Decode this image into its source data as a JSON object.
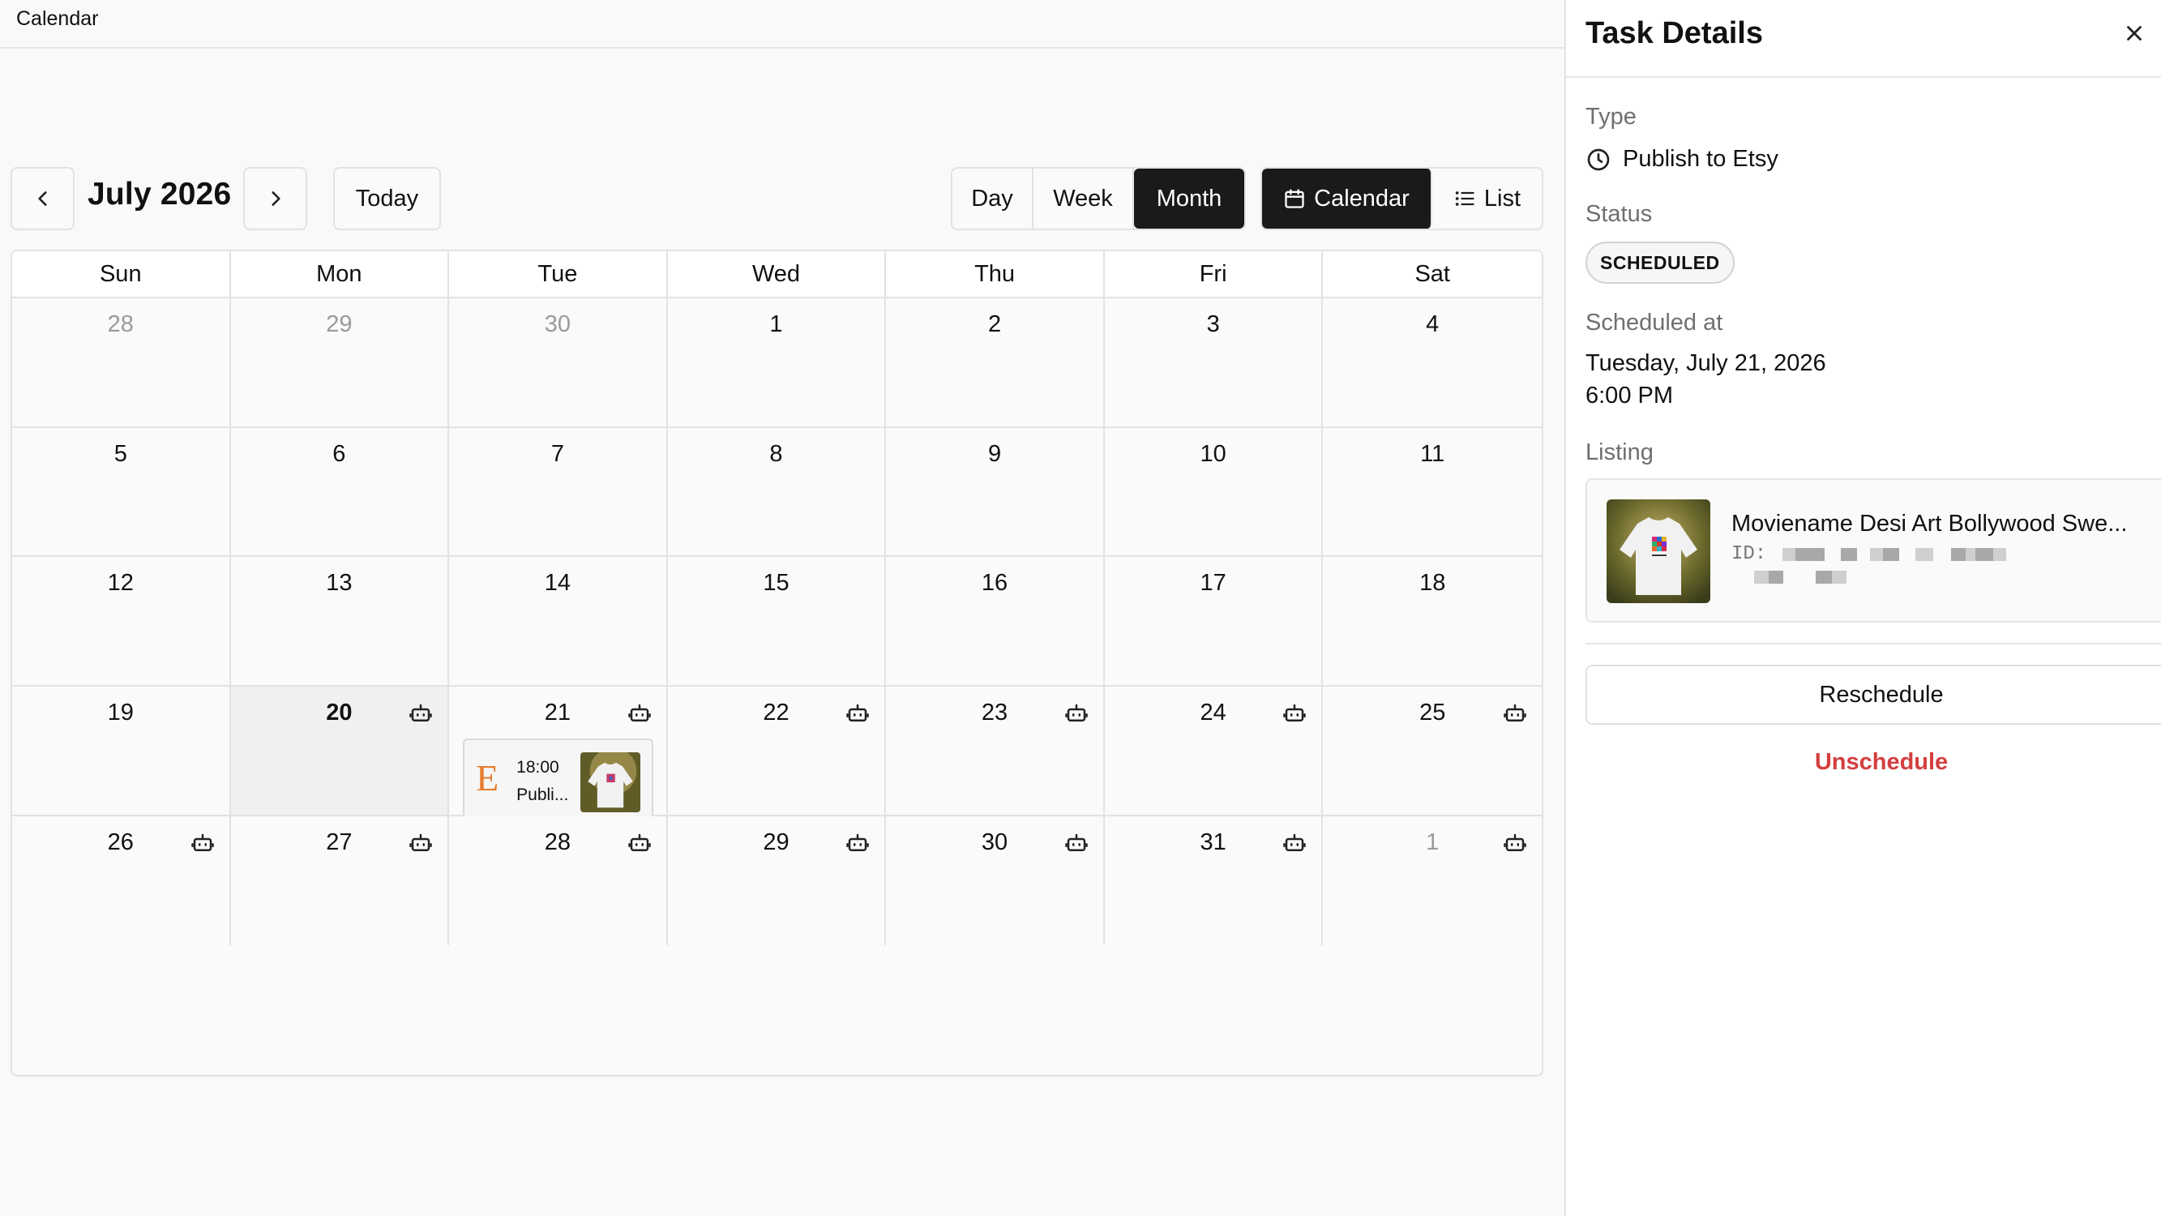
{
  "app": {
    "title": "Calendar"
  },
  "toolbar": {
    "month_label": "July 2026",
    "today_label": "Today",
    "views": [
      "Day",
      "Week",
      "Month"
    ],
    "active_view": "Month",
    "modes": [
      "Calendar",
      "List"
    ],
    "active_mode": "Calendar"
  },
  "calendar": {
    "weekdays": [
      "Sun",
      "Mon",
      "Tue",
      "Wed",
      "Thu",
      "Fri",
      "Sat"
    ],
    "weeks": [
      [
        {
          "d": "28",
          "out": true
        },
        {
          "d": "29",
          "out": true
        },
        {
          "d": "30",
          "out": true
        },
        {
          "d": "1"
        },
        {
          "d": "2"
        },
        {
          "d": "3"
        },
        {
          "d": "4"
        }
      ],
      [
        {
          "d": "5"
        },
        {
          "d": "6"
        },
        {
          "d": "7"
        },
        {
          "d": "8"
        },
        {
          "d": "9"
        },
        {
          "d": "10"
        },
        {
          "d": "11"
        }
      ],
      [
        {
          "d": "12"
        },
        {
          "d": "13"
        },
        {
          "d": "14"
        },
        {
          "d": "15"
        },
        {
          "d": "16"
        },
        {
          "d": "17"
        },
        {
          "d": "18"
        }
      ],
      [
        {
          "d": "19"
        },
        {
          "d": "20",
          "today": true,
          "bot": true
        },
        {
          "d": "21",
          "bot": true,
          "event": true
        },
        {
          "d": "22",
          "bot": true
        },
        {
          "d": "23",
          "bot": true
        },
        {
          "d": "24",
          "bot": true
        },
        {
          "d": "25",
          "bot": true
        }
      ],
      [
        {
          "d": "26",
          "bot": true
        },
        {
          "d": "27",
          "bot": true
        },
        {
          "d": "28",
          "bot": true
        },
        {
          "d": "29",
          "bot": true
        },
        {
          "d": "30",
          "bot": true
        },
        {
          "d": "31",
          "bot": true
        },
        {
          "d": "1",
          "out": true,
          "bot": true
        }
      ]
    ],
    "event": {
      "time": "18:00",
      "name": "Publi...",
      "icon": "etsy-icon",
      "icon_letter": "E"
    }
  },
  "panel": {
    "title": "Task Details",
    "type_label": "Type",
    "type_value": "Publish to Etsy",
    "status_label": "Status",
    "status_value": "SCHEDULED",
    "scheduled_label": "Scheduled at",
    "scheduled_date": "Tuesday, July 21, 2026",
    "scheduled_time": "6:00 PM",
    "listing_label": "Listing",
    "listing_title": "Moviename Desi Art Bollywood Swe...",
    "listing_id_prefix": "ID:",
    "reschedule_label": "Reschedule",
    "unschedule_label": "Unschedule"
  },
  "colors": {
    "accent": "#1a1a1a",
    "danger": "#d33f3f",
    "etsy": "#e57b2c"
  }
}
